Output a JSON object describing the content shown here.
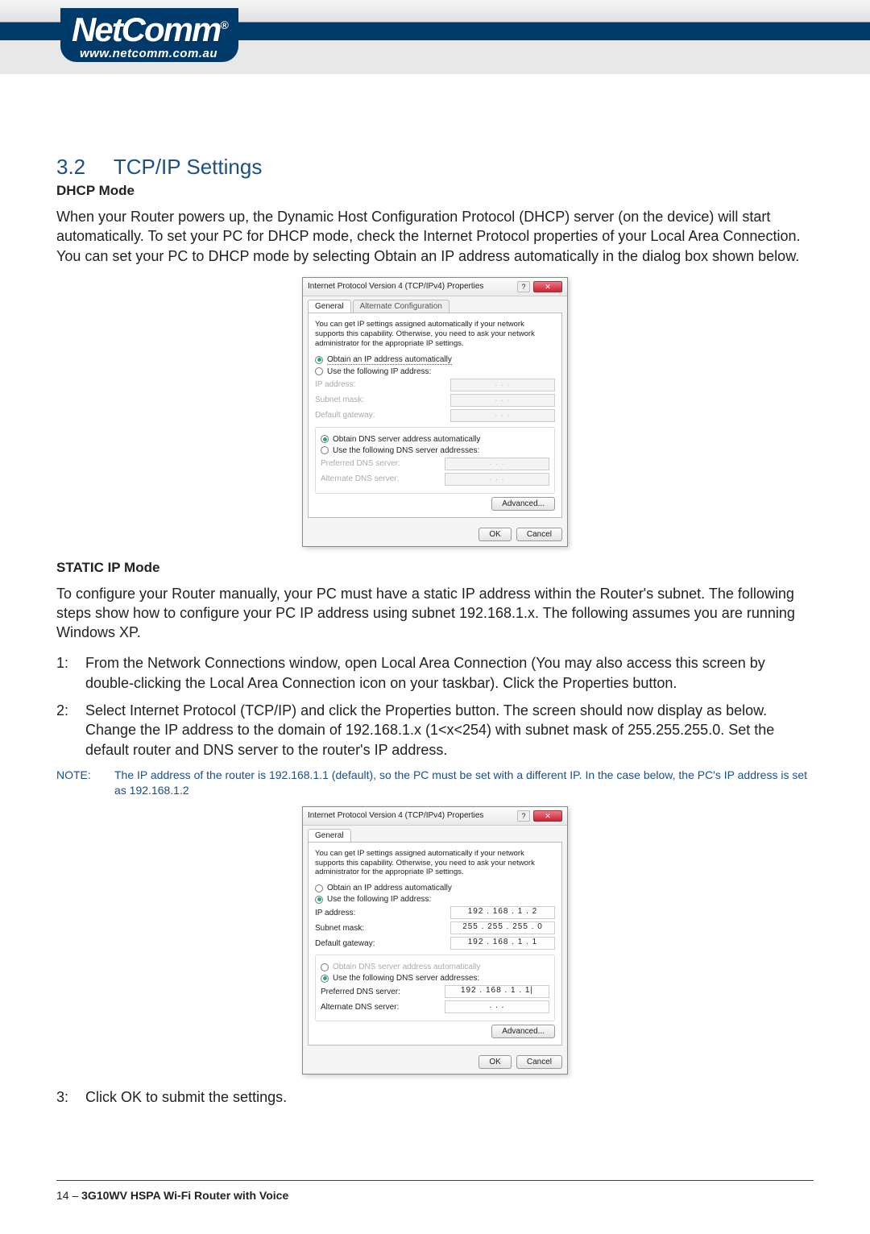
{
  "header": {
    "brand": "NetComm",
    "url": "www.netcomm.com.au"
  },
  "section": {
    "num": "3.2",
    "title": "TCP/IP Settings"
  },
  "dhcp": {
    "heading": "DHCP Mode",
    "body": "When your Router powers up, the Dynamic Host Configuration Protocol (DHCP) server (on the device) will start automatically. To set your PC for DHCP mode, check the Internet Protocol properties of your Local Area Connection. You can set your PC to DHCP mode by selecting Obtain an IP address automatically in the dialog box shown below."
  },
  "dialog1": {
    "title": "Internet Protocol Version 4 (TCP/IPv4) Properties",
    "tab_general": "General",
    "tab_alt": "Alternate Configuration",
    "help": "You can get IP settings assigned automatically if your network supports this capability. Otherwise, you need to ask your network administrator for the appropriate IP settings.",
    "obtain_ip": "Obtain an IP address automatically",
    "use_ip": "Use the following IP address:",
    "ip_label": "IP address:",
    "subnet_label": "Subnet mask:",
    "gateway_label": "Default gateway:",
    "obtain_dns": "Obtain DNS server address automatically",
    "use_dns": "Use the following DNS server addresses:",
    "pref_dns": "Preferred DNS server:",
    "alt_dns": "Alternate DNS server:",
    "advanced": "Advanced...",
    "ok": "OK",
    "cancel": "Cancel",
    "dots": ".    .    ."
  },
  "static": {
    "heading": "STATIC IP Mode",
    "body": "To configure your Router manually, your PC must have a static IP address within the Router's subnet. The following steps show how to configure your PC IP address using subnet 192.168.1.x. The following assumes you are running Windows XP.",
    "steps": [
      {
        "n": "1:",
        "t": "From the Network Connections window, open Local Area Connection (You may also access this screen by double-clicking the Local Area Connection icon on your taskbar). Click the Properties button."
      },
      {
        "n": "2:",
        "t": "Select Internet Protocol (TCP/IP) and click the Properties button. The screen should now display as below. Change the IP address to the domain of 192.168.1.x (1<x<254) with subnet mask of 255.255.255.0. Set the default router and DNS server to the router's IP address."
      }
    ],
    "note_label": "NOTE:",
    "note_text": "The IP address of the router is 192.168.1.1 (default), so the PC must be set with a different IP. In the case below, the PC's IP address is set as 192.168.1.2",
    "step3": {
      "n": "3:",
      "t": "Click OK to submit the settings."
    }
  },
  "dialog2": {
    "title": "Internet Protocol Version 4 (TCP/IPv4) Properties",
    "tab_general": "General",
    "help": "You can get IP settings assigned automatically if your network supports this capability. Otherwise, you need to ask your network administrator for the appropriate IP settings.",
    "obtain_ip": "Obtain an IP address automatically",
    "use_ip": "Use the following IP address:",
    "ip_label": "IP address:",
    "ip_val": "192 . 168 .  1  .  2",
    "subnet_label": "Subnet mask:",
    "subnet_val": "255 . 255 . 255 .  0",
    "gateway_label": "Default gateway:",
    "gateway_val": "192 . 168 .  1  .  1",
    "obtain_dns": "Obtain DNS server address automatically",
    "use_dns": "Use the following DNS server addresses:",
    "pref_dns": "Preferred DNS server:",
    "pref_dns_val": "192 . 168 .  1  .  1|",
    "alt_dns": "Alternate DNS server:",
    "alt_dns_val": ".    .    .",
    "advanced": "Advanced...",
    "ok": "OK",
    "cancel": "Cancel"
  },
  "footer": {
    "page": "14 – ",
    "product": "3G10WV HSPA Wi-Fi Router with Voice"
  }
}
